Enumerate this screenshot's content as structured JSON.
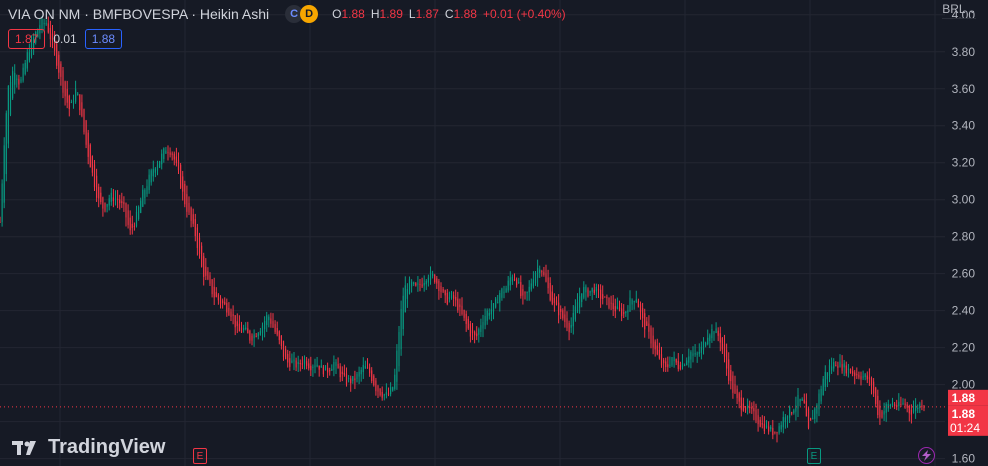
{
  "header": {
    "symbol": "VIA ON NM · BMFBOVESPA · Heikin Ashi",
    "badge_c": "C",
    "badge_d": "D",
    "ohlc": {
      "o_label": "O",
      "o_value": "1.88",
      "h_label": "H",
      "h_value": "1.89",
      "l_label": "L",
      "l_value": "1.87",
      "c_label": "C",
      "c_value": "1.88",
      "change": "+0.01 (+0.40%)"
    }
  },
  "price_boxes": {
    "bid": "1.87",
    "spread": "0.01",
    "ask": "1.88"
  },
  "currency": "BRL",
  "logo_text": "TradingView",
  "events": {
    "earnings_label": "E",
    "split_icon": "lightning-icon"
  },
  "colors": {
    "background": "#161a25",
    "up": "#089981",
    "down": "#f23645",
    "grid": "#232632",
    "text": "#d1d4dc"
  },
  "chart_data": {
    "type": "candlestick",
    "chart_style": "Heikin Ashi",
    "yaxis": {
      "ticks": [
        "4.00",
        "3.80",
        "3.60",
        "3.40",
        "3.20",
        "3.00",
        "2.80",
        "2.60",
        "2.40",
        "2.20",
        "2.00",
        "1.80",
        "1.60"
      ],
      "min": 1.56,
      "max": 4.08,
      "position": "right"
    },
    "grid": true,
    "last_price": "1.88",
    "last_price_2": "1.88",
    "countdown": "01:24",
    "close_path": [
      [
        0,
        2.88
      ],
      [
        4,
        3.3
      ],
      [
        8,
        3.6
      ],
      [
        14,
        3.72
      ],
      [
        20,
        3.62
      ],
      [
        28,
        3.8
      ],
      [
        34,
        3.88
      ],
      [
        40,
        3.95
      ],
      [
        46,
        3.96
      ],
      [
        52,
        3.85
      ],
      [
        58,
        3.72
      ],
      [
        64,
        3.58
      ],
      [
        70,
        3.48
      ],
      [
        76,
        3.6
      ],
      [
        80,
        3.5
      ],
      [
        86,
        3.3
      ],
      [
        92,
        3.15
      ],
      [
        98,
        3.0
      ],
      [
        104,
        2.95
      ],
      [
        110,
        3.02
      ],
      [
        118,
        3.0
      ],
      [
        124,
        2.95
      ],
      [
        130,
        2.82
      ],
      [
        136,
        2.9
      ],
      [
        142,
        3.02
      ],
      [
        148,
        3.1
      ],
      [
        154,
        3.18
      ],
      [
        160,
        3.22
      ],
      [
        166,
        3.28
      ],
      [
        172,
        3.26
      ],
      [
        178,
        3.15
      ],
      [
        184,
        3.0
      ],
      [
        190,
        2.9
      ],
      [
        196,
        2.8
      ],
      [
        202,
        2.62
      ],
      [
        208,
        2.55
      ],
      [
        214,
        2.48
      ],
      [
        220,
        2.45
      ],
      [
        226,
        2.42
      ],
      [
        232,
        2.38
      ],
      [
        238,
        2.28
      ],
      [
        244,
        2.3
      ],
      [
        250,
        2.25
      ],
      [
        256,
        2.28
      ],
      [
        262,
        2.32
      ],
      [
        268,
        2.38
      ],
      [
        274,
        2.3
      ],
      [
        280,
        2.22
      ],
      [
        286,
        2.12
      ],
      [
        292,
        2.12
      ],
      [
        298,
        2.1
      ],
      [
        304,
        2.14
      ],
      [
        310,
        2.1
      ],
      [
        316,
        2.12
      ],
      [
        322,
        2.08
      ],
      [
        328,
        2.08
      ],
      [
        334,
        2.12
      ],
      [
        340,
        2.06
      ],
      [
        346,
        2.02
      ],
      [
        352,
        2.02
      ],
      [
        358,
        2.05
      ],
      [
        364,
        2.1
      ],
      [
        370,
        2.06
      ],
      [
        376,
        1.98
      ],
      [
        382,
        1.95
      ],
      [
        388,
        1.94
      ],
      [
        394,
        2.0
      ],
      [
        400,
        2.35
      ],
      [
        404,
        2.52
      ],
      [
        410,
        2.55
      ],
      [
        416,
        2.52
      ],
      [
        422,
        2.55
      ],
      [
        428,
        2.6
      ],
      [
        434,
        2.58
      ],
      [
        440,
        2.52
      ],
      [
        446,
        2.45
      ],
      [
        452,
        2.48
      ],
      [
        458,
        2.42
      ],
      [
        464,
        2.35
      ],
      [
        470,
        2.28
      ],
      [
        476,
        2.25
      ],
      [
        482,
        2.35
      ],
      [
        488,
        2.4
      ],
      [
        494,
        2.42
      ],
      [
        500,
        2.5
      ],
      [
        506,
        2.52
      ],
      [
        512,
        2.6
      ],
      [
        518,
        2.55
      ],
      [
        522,
        2.45
      ],
      [
        528,
        2.5
      ],
      [
        534,
        2.6
      ],
      [
        540,
        2.65
      ],
      [
        546,
        2.55
      ],
      [
        552,
        2.45
      ],
      [
        558,
        2.4
      ],
      [
        564,
        2.35
      ],
      [
        570,
        2.3
      ],
      [
        576,
        2.42
      ],
      [
        582,
        2.52
      ],
      [
        588,
        2.5
      ],
      [
        594,
        2.52
      ],
      [
        600,
        2.48
      ],
      [
        606,
        2.45
      ],
      [
        612,
        2.42
      ],
      [
        618,
        2.4
      ],
      [
        624,
        2.38
      ],
      [
        630,
        2.45
      ],
      [
        636,
        2.48
      ],
      [
        642,
        2.35
      ],
      [
        648,
        2.28
      ],
      [
        654,
        2.2
      ],
      [
        660,
        2.12
      ],
      [
        666,
        2.08
      ],
      [
        672,
        2.15
      ],
      [
        678,
        2.1
      ],
      [
        684,
        2.12
      ],
      [
        690,
        2.18
      ],
      [
        696,
        2.15
      ],
      [
        702,
        2.2
      ],
      [
        708,
        2.28
      ],
      [
        714,
        2.3
      ],
      [
        720,
        2.25
      ],
      [
        726,
        2.1
      ],
      [
        732,
        1.98
      ],
      [
        738,
        1.9
      ],
      [
        744,
        1.88
      ],
      [
        750,
        1.86
      ],
      [
        756,
        1.82
      ],
      [
        762,
        1.78
      ],
      [
        768,
        1.76
      ],
      [
        774,
        1.74
      ],
      [
        780,
        1.78
      ],
      [
        786,
        1.85
      ],
      [
        792,
        1.86
      ],
      [
        798,
        1.92
      ],
      [
        804,
        1.9
      ],
      [
        808,
        1.74
      ],
      [
        812,
        1.82
      ],
      [
        818,
        1.92
      ],
      [
        824,
        2.05
      ],
      [
        830,
        2.1
      ],
      [
        836,
        2.12
      ],
      [
        842,
        2.1
      ],
      [
        848,
        2.08
      ],
      [
        854,
        2.06
      ],
      [
        860,
        2.05
      ],
      [
        866,
        2.04
      ],
      [
        872,
        2.0
      ],
      [
        876,
        1.88
      ],
      [
        880,
        1.82
      ],
      [
        886,
        1.88
      ],
      [
        892,
        1.9
      ],
      [
        898,
        1.88
      ],
      [
        904,
        1.9
      ],
      [
        910,
        1.85
      ],
      [
        916,
        1.88
      ],
      [
        922,
        1.9
      ],
      [
        926,
        1.88
      ]
    ]
  }
}
